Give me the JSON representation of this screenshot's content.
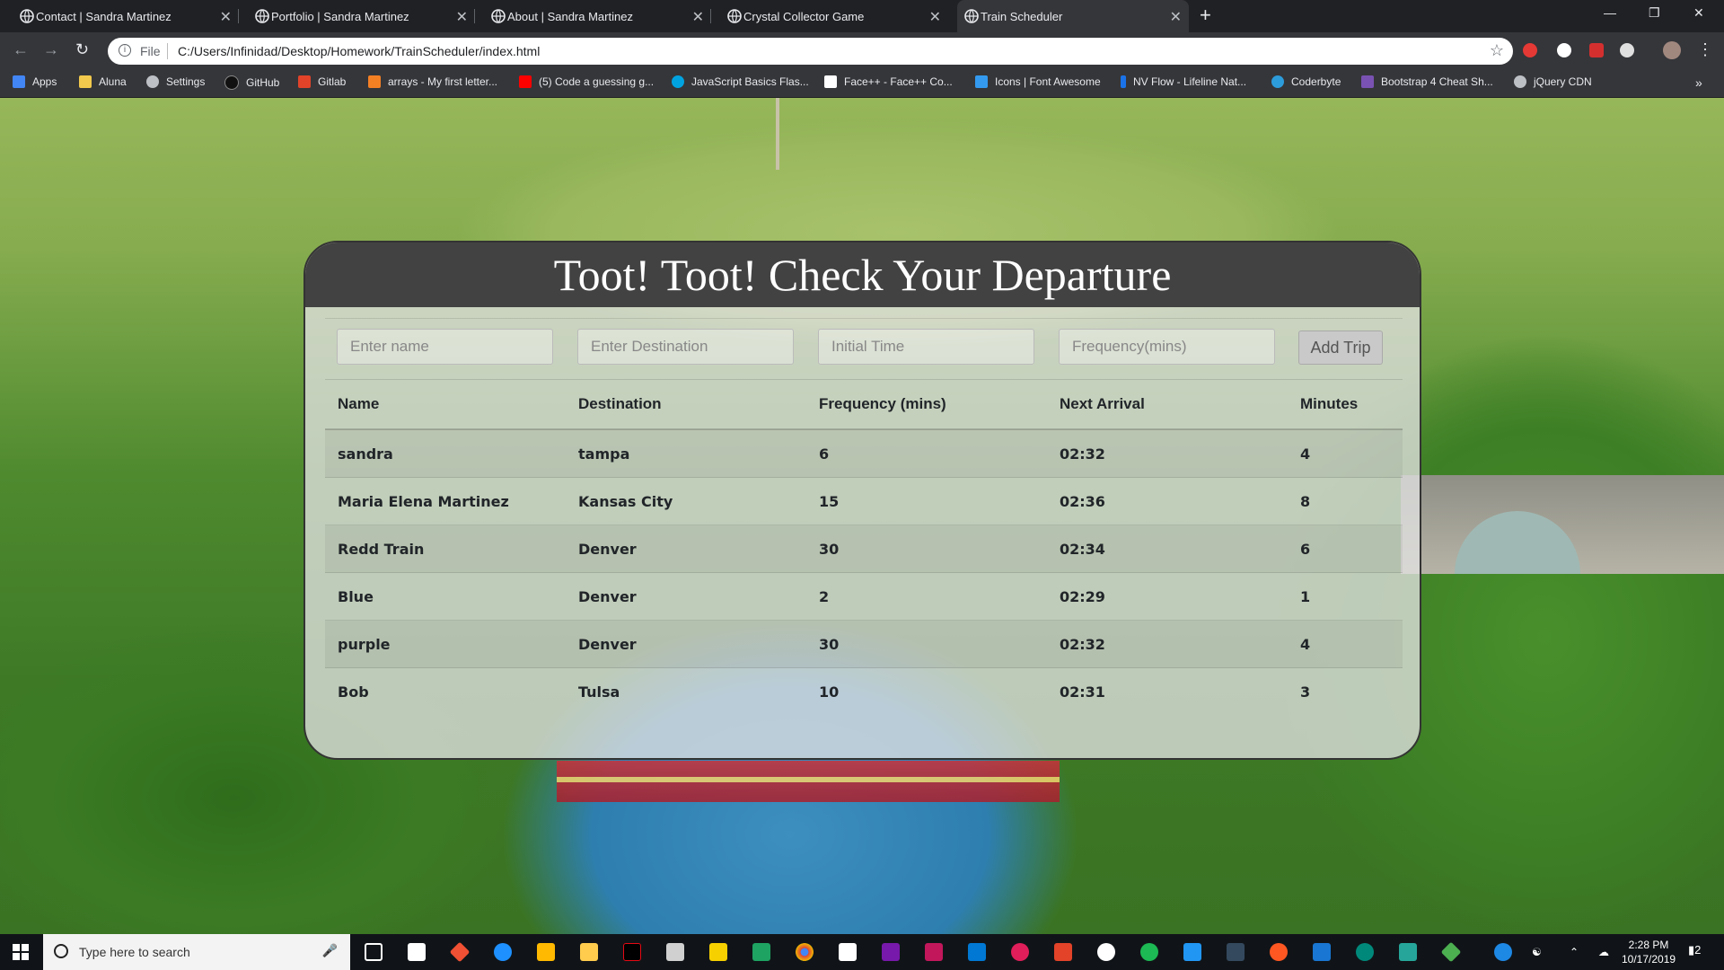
{
  "browser": {
    "tabs": [
      {
        "title": "Contact | Sandra Martinez",
        "active": false
      },
      {
        "title": "Portfolio | Sandra Martinez",
        "active": false
      },
      {
        "title": "About | Sandra Martinez",
        "active": false
      },
      {
        "title": "Crystal Collector Game",
        "active": false
      },
      {
        "title": "Train Scheduler",
        "active": true
      }
    ],
    "address": {
      "scheme_label": "File",
      "url": "C:/Users/Infinidad/Desktop/Homework/TrainScheduler/index.html"
    },
    "bookmarks": [
      {
        "label": "Apps",
        "color": "#4285f4"
      },
      {
        "label": "Aluna",
        "color": "#f2c94c"
      },
      {
        "label": "Settings",
        "color": "#bdc1c6"
      },
      {
        "label": "GitHub",
        "color": "#24292e"
      },
      {
        "label": "Gitlab",
        "color": "#e24329"
      },
      {
        "label": "arrays - My first letter...",
        "color": "#f48024"
      },
      {
        "label": "(5) Code a guessing g...",
        "color": "#ff0000"
      },
      {
        "label": "JavaScript Basics Flas...",
        "color": "#00a3e0"
      },
      {
        "label": "Face++ - Face++ Co...",
        "color": "#ffffff"
      },
      {
        "label": "Icons | Font Awesome",
        "color": "#339af0"
      },
      {
        "label": "NV Flow - Lifeline Nat...",
        "color": "#1a73e8"
      },
      {
        "label": "Coderbyte",
        "color": "#2d9cdb"
      },
      {
        "label": "Bootstrap 4 Cheat Sh...",
        "color": "#7952b3"
      },
      {
        "label": "jQuery CDN",
        "color": "#bdc1c6"
      }
    ]
  },
  "app": {
    "title": "Toot! Toot! Check Your Departure",
    "form": {
      "name_placeholder": "Enter name",
      "destination_placeholder": "Enter Destination",
      "time_placeholder": "Initial Time",
      "frequency_placeholder": "Frequency(mins)",
      "submit_label": "Add Trip"
    },
    "table": {
      "headers": [
        "Name",
        "Destination",
        "Frequency (mins)",
        "Next Arrival",
        "Minutes"
      ],
      "rows": [
        [
          "sandra",
          "tampa",
          "6",
          "02:32",
          "4"
        ],
        [
          "Maria Elena Martinez",
          "Kansas City",
          "15",
          "02:36",
          "8"
        ],
        [
          "Redd Train",
          "Denver",
          "30",
          "02:34",
          "6"
        ],
        [
          "Blue",
          "Denver",
          "2",
          "02:29",
          "1"
        ],
        [
          "purple",
          "Denver",
          "30",
          "02:32",
          "4"
        ],
        [
          "Bob",
          "Tulsa",
          "10",
          "02:31",
          "3"
        ]
      ]
    }
  },
  "taskbar": {
    "search_placeholder": "Type here to search",
    "time": "2:28 PM",
    "date": "10/17/2019",
    "notification_count": "2"
  }
}
